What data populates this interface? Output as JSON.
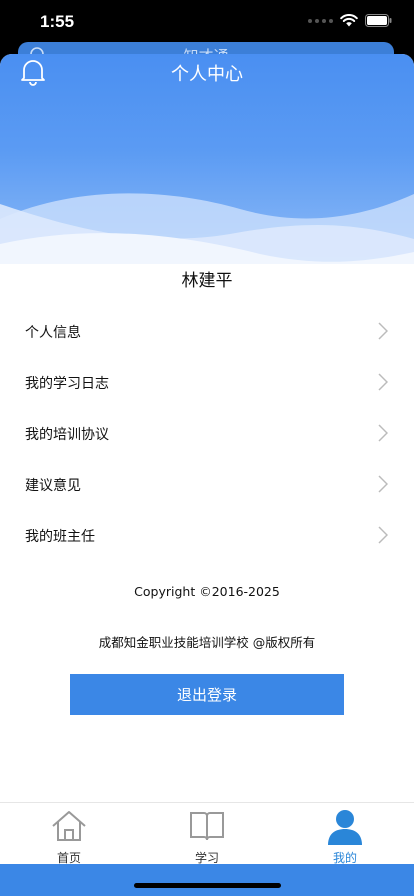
{
  "status_bar": {
    "time": "1:55"
  },
  "back_card": {
    "title": "知才通"
  },
  "header": {
    "title": "个人中心"
  },
  "user": {
    "name": "林建平"
  },
  "menu": {
    "items": [
      {
        "label": "个人信息"
      },
      {
        "label": "我的学习日志"
      },
      {
        "label": "我的培训协议"
      },
      {
        "label": "建议意见"
      },
      {
        "label": "我的班主任"
      }
    ]
  },
  "footer": {
    "copyright": "Copyright ©2016-2025",
    "owner": "成都知金职业技能培训学校  @版权所有"
  },
  "logout": {
    "label": "退出登录"
  },
  "tabbar": {
    "tabs": [
      {
        "label": "首页",
        "icon": "home-icon",
        "active": false
      },
      {
        "label": "学习",
        "icon": "book-icon",
        "active": false
      },
      {
        "label": "我的",
        "icon": "person-icon",
        "active": true
      }
    ]
  },
  "colors": {
    "primary": "#3b87e6",
    "active_tab": "#2a86d8",
    "header_top": "#4a8ff2"
  }
}
